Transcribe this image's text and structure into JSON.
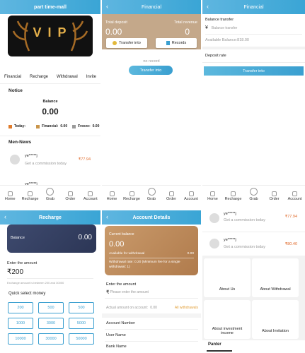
{
  "panel1": {
    "title": "part time-mall",
    "banner_text": "V I P",
    "banner_sub": "VIP",
    "menu": [
      "Financial",
      "Recharge",
      "Withdrawal",
      "Invite"
    ],
    "notice_title": "Notice",
    "balance_label": "Balance",
    "balance_value": "0.00",
    "today_label": "Today:",
    "financial_label": "Financial:",
    "financial_value": "0.00",
    "freeze_label": "Freeze:",
    "freeze_value": "0.00",
    "news_title": "Men-News",
    "news_user": "ye*****j",
    "news_text": "Get a commission today",
    "news_amount": "₹77.94",
    "news_user2": "ye*****j",
    "colors": {
      "today": "#e07b2a",
      "financial": "#c9954b",
      "freeze": "#9a9a9a",
      "amount": "#e06a2a"
    }
  },
  "tabs": [
    "Home",
    "Recharge",
    "Grab",
    "Order",
    "Account"
  ],
  "panel2": {
    "title": "Financial",
    "total_deposit_label": "Total deposit",
    "total_deposit_value": "0.00",
    "total_revenue_label": "Total revenue",
    "total_revenue_value": "0",
    "transfer_into_label": "Transfer into",
    "records_label": "Records",
    "no_record": "no record",
    "transfer_btn": "Transfer into"
  },
  "panel3": {
    "title": "Financial",
    "balance_transfer": "Balance transfer",
    "currency": "¥",
    "placeholder": "Balance transfer",
    "available": "Available Balance:818.00",
    "deposit_rate": "Deposit rate",
    "transfer_btn": "Transfer into"
  },
  "panel4": {
    "title": "Recharge",
    "balance_label": "Balance",
    "balance_value": "0.00",
    "enter_amount": "Enter the amount",
    "amount": "₹200",
    "hint": "Exchange amount is between 200 and 30000",
    "quick_label": "Quick select money",
    "options": [
      "200",
      "500",
      "500",
      "1000",
      "3000",
      "5000",
      "10000",
      "30000",
      "50000"
    ]
  },
  "panel5": {
    "title": "Account Details",
    "current_balance_label": "Current balance",
    "current_balance_value": "0.00",
    "available_label": "Available for withdrawal",
    "available_value": "0.00",
    "withdrawal_rate": "Withdrawal rate:  0.20  (Minimum fee for a single withdrawal:  1)",
    "enter_amount": "Enter the amount",
    "currency": "₹",
    "placeholder": "Please enter the amount",
    "actual_label": "Actual amount on account:",
    "actual_value": "0.00",
    "all_withdrawals": "All withdrawals",
    "account_number": "Account Number",
    "user_name": "User Name",
    "bank_name": "Bank Name"
  },
  "panel6": {
    "news": [
      {
        "user": "ye*****j",
        "text": "Get a commission today",
        "amount": "₹77.94"
      },
      {
        "user": "ye*****j",
        "text": "Get a commission today",
        "amount": "₹80.40"
      }
    ],
    "cards": [
      "About Us",
      "About Withdrawal",
      "About investment income",
      "About Invitation"
    ],
    "partner": "Panter"
  }
}
